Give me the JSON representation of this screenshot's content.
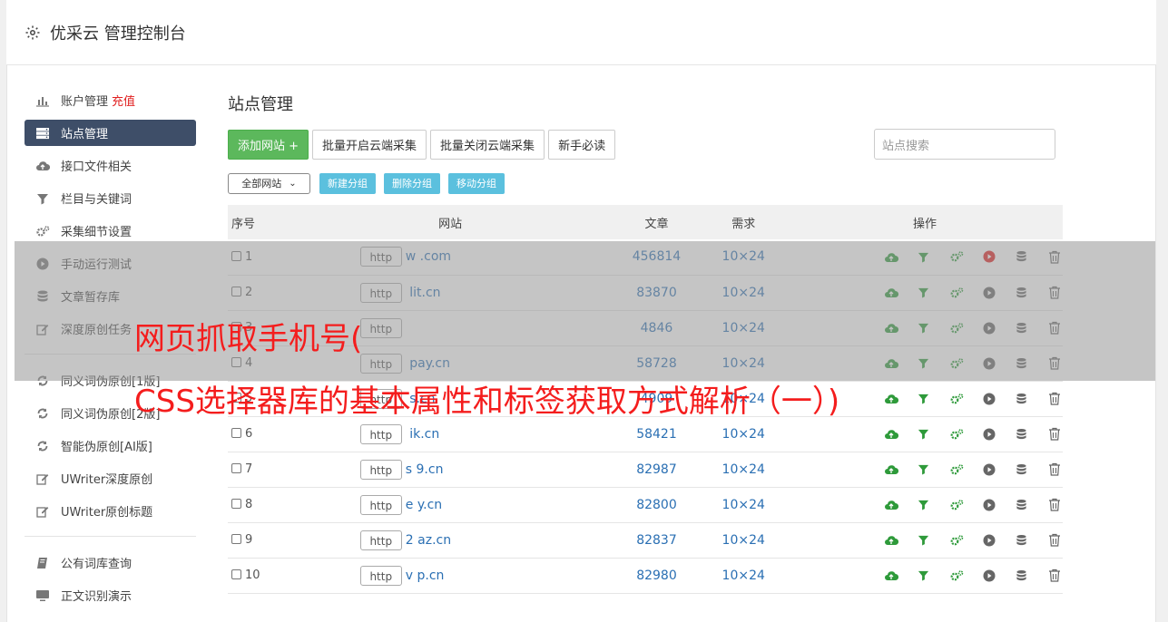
{
  "header": {
    "title": "优采云 管理控制台"
  },
  "sidebar": {
    "group1": [
      {
        "label": "账户管理",
        "extra": "充值",
        "icon": "bar-chart-icon",
        "active": false
      },
      {
        "label": "站点管理",
        "icon": "server-icon",
        "active": true
      },
      {
        "label": "接口文件相关",
        "icon": "cloud-upload-icon",
        "active": false
      },
      {
        "label": "栏目与关键词",
        "icon": "filter-icon",
        "active": false
      },
      {
        "label": "采集细节设置",
        "icon": "cogs-icon",
        "active": false
      },
      {
        "label": "手动运行测试",
        "icon": "play-circle-icon",
        "active": false
      },
      {
        "label": "文章暂存库",
        "icon": "database-icon",
        "active": false
      },
      {
        "label": "深度原创任务",
        "icon": "edit-icon",
        "active": false
      }
    ],
    "group2": [
      {
        "label": "同义词伪原创[1版]",
        "icon": "refresh-icon"
      },
      {
        "label": "同义词伪原创[2版]",
        "icon": "refresh-icon"
      },
      {
        "label": "智能伪原创[AI版]",
        "icon": "refresh-icon"
      },
      {
        "label": "UWriter深度原创",
        "icon": "edit-icon"
      },
      {
        "label": "UWriter原创标题",
        "icon": "edit-icon"
      }
    ],
    "group3": [
      {
        "label": "公有词库查询",
        "icon": "book-icon"
      },
      {
        "label": "正文识别演示",
        "icon": "monitor-icon"
      }
    ]
  },
  "main": {
    "title": "站点管理",
    "buttons": {
      "add": "添加网站 +",
      "batch_open": "批量开启云端采集",
      "batch_close": "批量关闭云端采集",
      "guide": "新手必读"
    },
    "search_placeholder": "站点搜索",
    "group_select": "全部网站",
    "group_buttons": [
      "新建分组",
      "删除分组",
      "移动分组"
    ],
    "table": {
      "headers": {
        "no": "序号",
        "site": "网站",
        "articles": "文章",
        "demand": "需求",
        "ops": "操作"
      },
      "rows": [
        {
          "no": "1",
          "protocol": "http",
          "domain": "w          .com",
          "articles": "456814",
          "demand": "10×24",
          "running": true
        },
        {
          "no": "2",
          "protocol": "http",
          "domain": "     lit.cn",
          "articles": "83870",
          "demand": "10×24",
          "running": false
        },
        {
          "no": "3",
          "protocol": "http",
          "domain": "",
          "articles": "4846",
          "demand": "10×24",
          "running": false
        },
        {
          "no": "4",
          "protocol": "http",
          "domain": "      pay.cn",
          "articles": "58728",
          "demand": "10×24",
          "running": false
        },
        {
          "no": "5",
          "protocol": "http",
          "domain": "     s.cn",
          "articles": "4909",
          "demand": "10×24",
          "running": false
        },
        {
          "no": "6",
          "protocol": "http",
          "domain": "     ik.cn",
          "articles": "58421",
          "demand": "10×24",
          "running": false
        },
        {
          "no": "7",
          "protocol": "http",
          "domain": "s    9.cn",
          "articles": "82987",
          "demand": "10×24",
          "running": false
        },
        {
          "no": "8",
          "protocol": "http",
          "domain": "e     y.cn",
          "articles": "82800",
          "demand": "10×24",
          "running": false
        },
        {
          "no": "9",
          "protocol": "http",
          "domain": "2     az.cn",
          "articles": "82837",
          "demand": "10×24",
          "running": false
        },
        {
          "no": "10",
          "protocol": "http",
          "domain": "v     p.cn",
          "articles": "82980",
          "demand": "10×24",
          "running": false
        }
      ]
    }
  },
  "overlay": {
    "line1": "网页抓取手机号(",
    "line2": "CSS选择器库的基本属性和标签获取方式解析（一）)"
  },
  "colors": {
    "sidebar_active": "#3e4e68",
    "link": "#2a6fb3",
    "green": "#5cb85c",
    "info": "#5bc0de",
    "danger": "#e02020",
    "overlay_text": "#f41d1d"
  }
}
